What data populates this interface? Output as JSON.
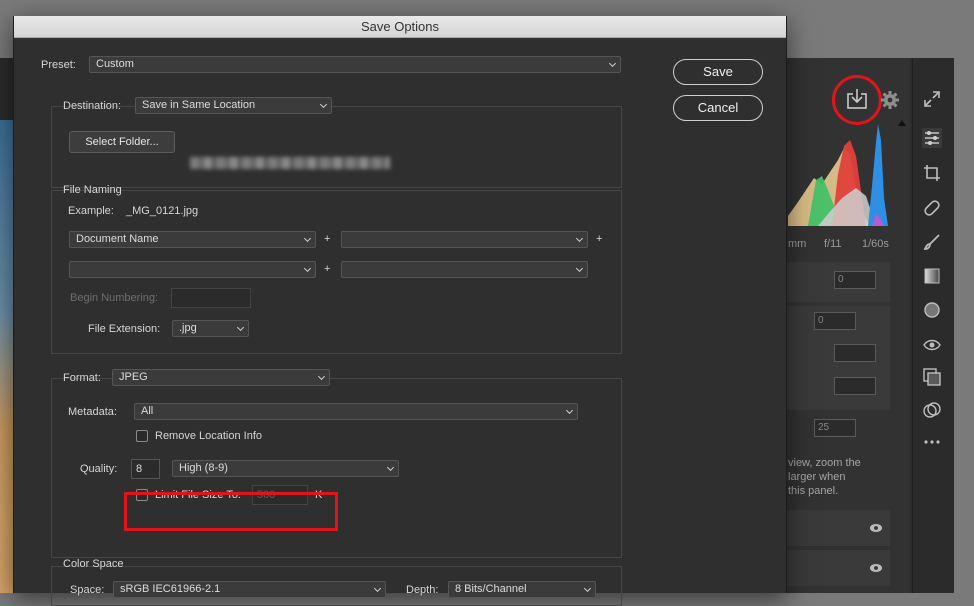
{
  "dialog": {
    "title": "Save Options",
    "save_label": "Save",
    "cancel_label": "Cancel",
    "preset": {
      "label": "Preset:",
      "value": "Custom"
    },
    "destination": {
      "label": "Destination:",
      "value": "Save in Same Location",
      "select_folder_label": "Select Folder..."
    },
    "file_naming": {
      "title": "File Naming",
      "example_label": "Example:",
      "example_value": "_MG_0121.jpg",
      "name_fields": [
        "Document Name",
        "",
        "",
        ""
      ],
      "plus": "+",
      "begin_numbering_label": "Begin Numbering:",
      "file_extension_label": "File Extension:",
      "file_extension_value": ".jpg"
    },
    "format": {
      "label": "Format:",
      "value": "JPEG",
      "metadata_label": "Metadata:",
      "metadata_value": "All",
      "remove_location_label": "Remove Location Info",
      "quality_label": "Quality:",
      "quality_value": "8",
      "quality_preset": "High  (8-9)",
      "limit_label": "Limit File Size To:",
      "limit_placeholder": "500",
      "limit_unit": "K"
    },
    "color_space": {
      "title": "Color Space",
      "space_label": "Space:",
      "space_value": "sRGB IEC61966-2.1",
      "depth_label": "Depth:",
      "depth_value": "8 Bits/Channel"
    }
  },
  "background": {
    "readouts": [
      "mm",
      "f/11",
      "1/60s"
    ],
    "fields": [
      "0",
      "0",
      "25"
    ],
    "hint_text": [
      "view, zoom the",
      "larger when",
      "this panel."
    ]
  },
  "colors": {
    "highlight": "#e0151c",
    "dialog_bg": "#2f2f2f",
    "titlebar": "#d9d9d9"
  },
  "icons": [
    "save-image-icon",
    "gear-icon",
    "fullscreen-icon",
    "edit-sliders-icon",
    "crop-icon",
    "healing-icon",
    "brush-icon",
    "gradient-icon",
    "radial-filter-icon",
    "red-eye-icon",
    "snapshots-icon",
    "presets-icon",
    "more-icon",
    "eye-icon"
  ]
}
